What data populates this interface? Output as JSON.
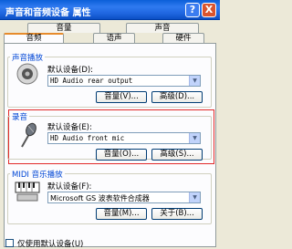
{
  "window": {
    "title": "声音和音频设备 属性",
    "help_glyph": "?",
    "close_glyph": "X"
  },
  "tabs": {
    "row1": [
      "音量",
      "声音"
    ],
    "row2": [
      "音频",
      "语声",
      "硬件"
    ],
    "active": "音频"
  },
  "playback": {
    "title": "声音播放",
    "default_device_label": "默认设备(D):",
    "device": "HD Audio rear output",
    "volume_button": "音量(V)...",
    "advanced_button": "高级(D)..."
  },
  "recording": {
    "title": "录音",
    "default_device_label": "默认设备(E):",
    "device": "HD Audio front mic",
    "volume_button": "音量(O)...",
    "advanced_button": "高级(S)..."
  },
  "midi": {
    "title": "MIDI 音乐播放",
    "default_device_label": "默认设备(F):",
    "device": "Microsoft GS 波表软件合成器",
    "volume_button": "音量(M)...",
    "about_button": "关于(B)..."
  },
  "use_default_only_label": "仅使用默认设备(U)",
  "colors": {
    "titlebar": "#1f66e0",
    "group_title": "#0046d5",
    "highlight_frame": "#e22a2a",
    "active_tab_accent": "#e68b2c"
  },
  "icons": [
    "speaker-icon",
    "microphone-icon",
    "midi-keyboard-icon",
    "chevron-down-icon"
  ]
}
